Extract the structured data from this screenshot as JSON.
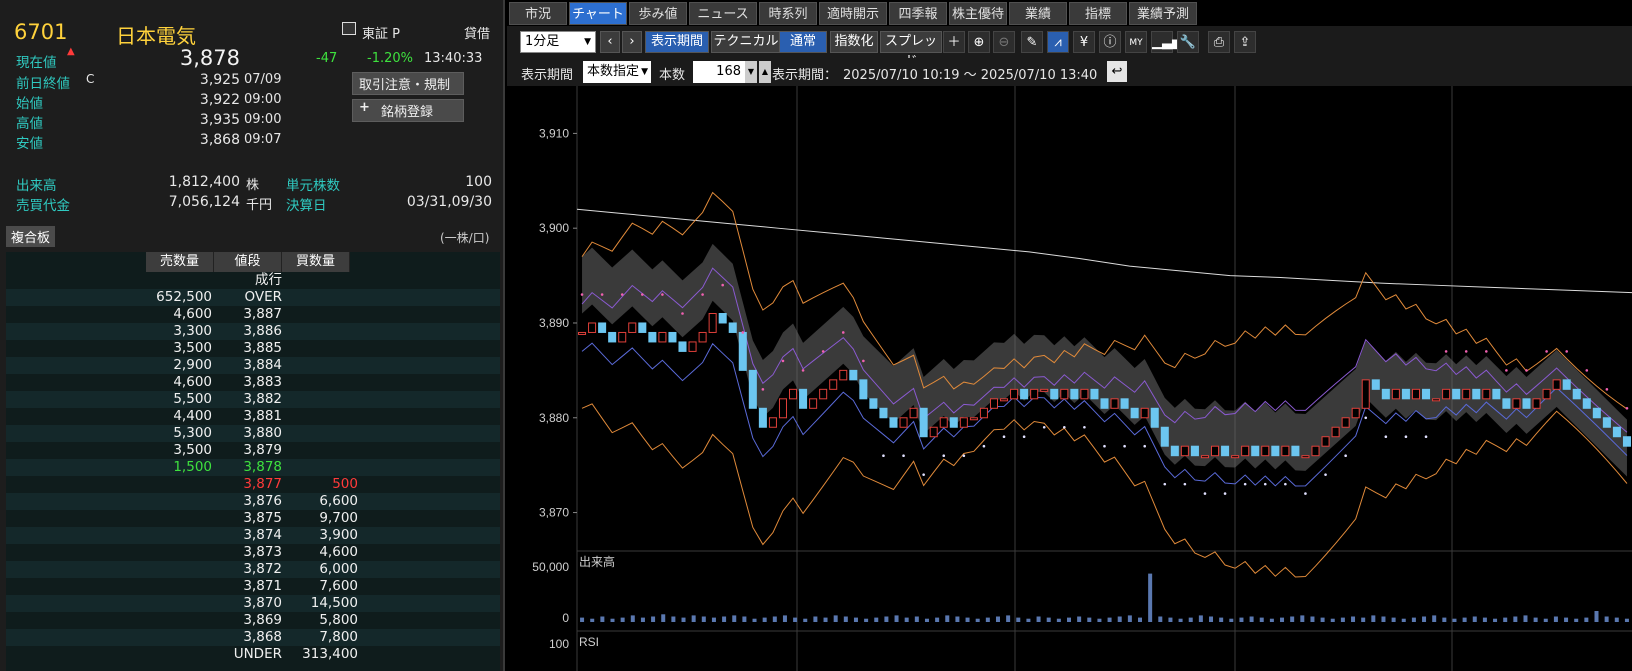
{
  "quote": {
    "code": "6701",
    "name": "日本電気",
    "exchange": "東証 P",
    "lending": "貸借",
    "current_label": "現在値",
    "current_price": "3,878",
    "change": "-47",
    "change_pct": "-1.20%",
    "time": "13:40:33",
    "rows": [
      {
        "label": "前日終値",
        "flag": "C",
        "value": "3,925",
        "time": "07/09"
      },
      {
        "label": "始値",
        "flag": "",
        "value": "3,922",
        "time": "09:00"
      },
      {
        "label": "高値",
        "flag": "",
        "value": "3,935",
        "time": "09:00"
      },
      {
        "label": "安値",
        "flag": "",
        "value": "3,868",
        "time": "09:07"
      }
    ],
    "volume_label": "出来高",
    "volume": "1,812,400",
    "volume_unit": "株",
    "turnover_label": "売買代金",
    "turnover": "7,056,124",
    "turnover_unit": "千円",
    "unit_label": "単元株数",
    "unit_value": "100",
    "settle_label": "決算日",
    "settle_value": "03/31,09/30",
    "btn_caution": "取引注意・規制",
    "btn_register": "銘柄登録",
    "register_plus": "+"
  },
  "book": {
    "tab": "複合板",
    "unit_note": "(一株/口)",
    "headers": [
      "売数量",
      "値段",
      "買数量"
    ],
    "market_label": "成行",
    "rows": [
      {
        "sell": "652,500",
        "price": "OVER",
        "buy": ""
      },
      {
        "sell": "4,600",
        "price": "3,887",
        "buy": ""
      },
      {
        "sell": "3,300",
        "price": "3,886",
        "buy": ""
      },
      {
        "sell": "3,500",
        "price": "3,885",
        "buy": ""
      },
      {
        "sell": "2,900",
        "price": "3,884",
        "buy": ""
      },
      {
        "sell": "4,600",
        "price": "3,883",
        "buy": ""
      },
      {
        "sell": "5,500",
        "price": "3,882",
        "buy": ""
      },
      {
        "sell": "4,400",
        "price": "3,881",
        "buy": ""
      },
      {
        "sell": "5,300",
        "price": "3,880",
        "buy": ""
      },
      {
        "sell": "3,500",
        "price": "3,879",
        "buy": ""
      },
      {
        "sell": "1,500",
        "price": "3,878",
        "buy": "",
        "hl": "green"
      },
      {
        "sell": "",
        "price": "3,877",
        "buy": "500",
        "hl": "red"
      },
      {
        "sell": "",
        "price": "3,876",
        "buy": "6,600"
      },
      {
        "sell": "",
        "price": "3,875",
        "buy": "9,700"
      },
      {
        "sell": "",
        "price": "3,874",
        "buy": "3,900"
      },
      {
        "sell": "",
        "price": "3,873",
        "buy": "4,600"
      },
      {
        "sell": "",
        "price": "3,872",
        "buy": "6,000"
      },
      {
        "sell": "",
        "price": "3,871",
        "buy": "7,600"
      },
      {
        "sell": "",
        "price": "3,870",
        "buy": "14,500"
      },
      {
        "sell": "",
        "price": "3,869",
        "buy": "5,800"
      },
      {
        "sell": "",
        "price": "3,868",
        "buy": "7,800"
      },
      {
        "sell": "",
        "price": "UNDER",
        "buy": "313,400"
      }
    ]
  },
  "tabs": [
    "市況",
    "チャート",
    "歩み値",
    "ニュース",
    "時系列",
    "適時開示",
    "四季報",
    "株主優待",
    "業績",
    "指標",
    "業績予測"
  ],
  "active_tab": "チャート",
  "toolbar": {
    "interval": "1分足",
    "period_btn": "表示期間",
    "technical_btn": "テクニカル",
    "normal_btn": "通常",
    "index_btn": "指数化",
    "spread_btn": "スプレッド",
    "icons": [
      "crosshair-icon",
      "zoom-in-icon",
      "zoom-out-icon",
      "pencil-icon",
      "chart-cursor-icon",
      "yen-icon",
      "info-icon",
      "my-icon",
      "area-chart-icon",
      "wrench-icon",
      "print-icon",
      "export-icon"
    ]
  },
  "period": {
    "label": "表示期間",
    "mode": "本数指定",
    "count_label": "本数",
    "count": "168",
    "range_label": "表示期間：",
    "range": "2025/07/10 10:19 〜 2025/07/10 13:40"
  },
  "chart_data": {
    "type": "line",
    "title": "",
    "price_axis": {
      "ticks": [
        3910,
        3900,
        3890,
        3880,
        3870
      ],
      "tick_labels": [
        "3,910",
        "3,900",
        "3,890",
        "3,880",
        "3,870"
      ],
      "ylim": [
        3867,
        3915
      ]
    },
    "close_series": [
      3889,
      3890,
      3889,
      3888,
      3889,
      3890,
      3889,
      3888,
      3889,
      3888,
      3887,
      3888,
      3889,
      3891,
      3890,
      3889,
      3885,
      3881,
      3879,
      3880,
      3882,
      3883,
      3881,
      3882,
      3883,
      3884,
      3885,
      3884,
      3882,
      3881,
      3880,
      3879,
      3880,
      3881,
      3878,
      3879,
      3880,
      3879,
      3880,
      3880,
      3881,
      3882,
      3882,
      3883,
      3882,
      3883,
      3883,
      3882,
      3883,
      3882,
      3883,
      3882,
      3881,
      3882,
      3881,
      3880,
      3881,
      3879,
      3877,
      3876,
      3877,
      3876,
      3876,
      3877,
      3876,
      3876,
      3877,
      3876,
      3877,
      3876,
      3877,
      3876,
      3876,
      3877,
      3878,
      3879,
      3880,
      3881,
      3884,
      3883,
      3882,
      3883,
      3882,
      3883,
      3882,
      3882,
      3883,
      3882,
      3883,
      3882,
      3883,
      3882,
      3881,
      3882,
      3881,
      3882,
      3883,
      3884,
      3883,
      3882,
      3881,
      3880,
      3879,
      3878,
      3877
    ],
    "sma_long": [
      3902,
      3901.5,
      3901,
      3900.5,
      3900,
      3899.5,
      3899,
      3898.5,
      3898,
      3897.5,
      3896.8,
      3896,
      3895.5,
      3895,
      3894.8,
      3894.5,
      3894.2,
      3894,
      3893.8,
      3893.6,
      3893.4,
      3893.2
    ],
    "volume_label": "出来高",
    "volume_axis": {
      "ticks": [
        50000,
        0
      ],
      "tick_labels": [
        "50,000",
        "0"
      ]
    },
    "volume_series": [
      4,
      3,
      5,
      3,
      4,
      6,
      4,
      5,
      7,
      5,
      4,
      6,
      5,
      4,
      5,
      6,
      5,
      3,
      4,
      5,
      6,
      4,
      3,
      5,
      4,
      6,
      5,
      4,
      3,
      4,
      5,
      6,
      4,
      5,
      3,
      4,
      6,
      5,
      4,
      3,
      4,
      5,
      6,
      4,
      3,
      5,
      4,
      3,
      4,
      5,
      4,
      3,
      4,
      5,
      6,
      4,
      44,
      5,
      4,
      3,
      4,
      6,
      5,
      4,
      3,
      4,
      5,
      4,
      3,
      4,
      5,
      6,
      5,
      4,
      3,
      4,
      5,
      4,
      6,
      5,
      4,
      3,
      4,
      5,
      6,
      4,
      3,
      4,
      5,
      4,
      3,
      4,
      5,
      6,
      4,
      3,
      5,
      4,
      3,
      4,
      10,
      5,
      4,
      3
    ],
    "rsi_label": "RSI",
    "rsi_axis": {
      "ticks": [
        100
      ],
      "tick_labels": [
        "100"
      ]
    }
  }
}
